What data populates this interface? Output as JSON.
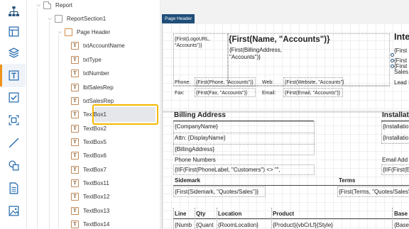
{
  "toolbar": {
    "icons": [
      "sitemap-icon",
      "layout-icon",
      "layers-icon",
      "textbox-icon",
      "checkbox-icon",
      "image-placeholder-icon",
      "line-icon",
      "shapes-icon",
      "document-icon",
      "picture-icon"
    ],
    "accent_color": "#f0931c"
  },
  "tree": {
    "items": [
      {
        "label": "Report"
      },
      {
        "label": "ReportSection1"
      },
      {
        "label": "Page Header"
      },
      {
        "label": "txtAccountName"
      },
      {
        "label": "txtType"
      },
      {
        "label": "txtNumber"
      },
      {
        "label": "lblSalesRep"
      },
      {
        "label": "txtSalesRep"
      },
      {
        "label": "TextBox1"
      },
      {
        "label": "TextBox2"
      },
      {
        "label": "TextBox5"
      },
      {
        "label": "TextBox6"
      },
      {
        "label": "TextBox7"
      },
      {
        "label": "TextBox11"
      },
      {
        "label": "TextBox12"
      },
      {
        "label": "TextBox13"
      },
      {
        "label": "TextBox14"
      }
    ],
    "selected": "TextBox1",
    "selection_color": "#f5b700"
  },
  "canvas": {
    "page_header_tab": "Page Header",
    "header_color": "#1f4e79",
    "fields": {
      "logo_url": "{First(LogoURL, \"Accounts\")}",
      "name": "{First(Name, \"Accounts\")}",
      "billing_address": "{First(BillingAddress, \"Accounts\")}",
      "inte": "Inte",
      "first1": "{First",
      "first2": "{First",
      "first3": "{First",
      "sales": "Sales",
      "lead_s": "Lead S",
      "phone_label": "Phone:",
      "phone_value": "{First(Phone, \"Accounts\")}",
      "web_label": "Web:",
      "web_value": "{First(Website, \"Accounts\")}",
      "fax_label": "Fax:",
      "fax_value": "{First(Fax, \"Accounts\")}",
      "email_label": "Email:",
      "email_value": "{First(Email, \"Accounts\")}",
      "billing_heading": "Billing Address",
      "installation_heading": "Installatio",
      "company_name": "{CompanyName}",
      "installation1": "{Installatio",
      "installation2": "{Installatio",
      "attn": "Attn: {DisplayName}",
      "billing_addr": "{BillingAddress}",
      "phone_numbers": "Phone Numbers",
      "email_add": "Email Add",
      "iif_phone": "{IIF(First(PhoneLabel, \"Customers\") <> \"\",",
      "iif_e": "{IIF(First(E",
      "sidemark_label": "Sidemark",
      "terms_label": "Terms",
      "sidemark_value": "{First(Sidemark, \"Quotes/Sales\")}",
      "terms_value": "{First(Terms, \"Quotes/Sales\"",
      "col_line": "Line",
      "col_qty": "Qty",
      "col_location": "Location",
      "col_product": "Product",
      "col_base": "Base",
      "row_numb": "{Numb",
      "row_quant": "{Quant",
      "row_room": "{RoomLocation}",
      "row_product": "{Product}{vbCrLf}{Style}",
      "row_base": "{Base"
    }
  }
}
